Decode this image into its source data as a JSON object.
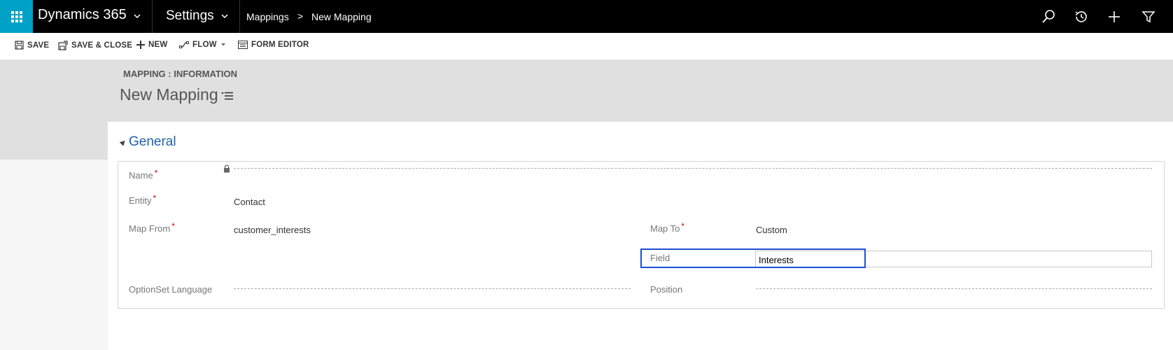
{
  "topbar": {
    "app_title": "Dynamics 365",
    "area_title": "Settings",
    "breadcrumb": [
      "Mappings",
      "New Mapping"
    ],
    "breadcrumb_separator": ">",
    "icons": [
      "search-icon",
      "recent-icon",
      "add-icon",
      "filter-icon"
    ],
    "accent_color": "#00a1c7"
  },
  "commandbar": {
    "save": "SAVE",
    "save_close": "SAVE & CLOSE",
    "new": "NEW",
    "flow": "FLOW",
    "form_editor": "FORM EDITOR"
  },
  "header": {
    "entity_label": "MAPPING : INFORMATION",
    "record_title": "New Mapping"
  },
  "section": {
    "title": "General"
  },
  "form": {
    "name_label": "Name",
    "name_value": "",
    "entity_label": "Entity",
    "entity_value": "Contact",
    "map_from_label": "Map From",
    "map_from_value": "customer_interests",
    "map_to_label": "Map To",
    "map_to_value": "Custom",
    "field_label": "Field",
    "field_value": "Interests",
    "optionset_label": "OptionSet Language",
    "position_label": "Position",
    "required_mark": "*"
  }
}
